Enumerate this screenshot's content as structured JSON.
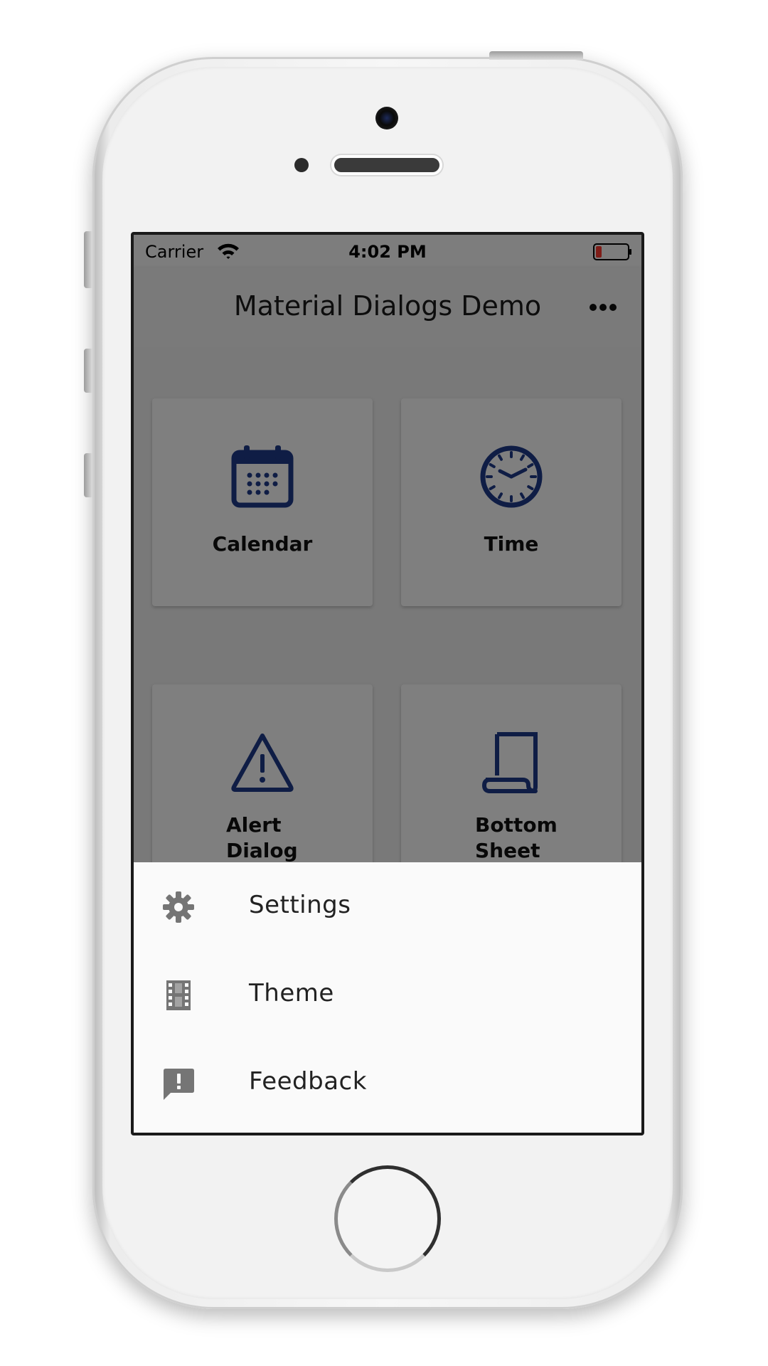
{
  "status_bar": {
    "carrier": "Carrier",
    "time": "4:02 PM",
    "wifi_icon": "wifi-icon",
    "battery_icon": "battery-low-icon",
    "battery_color": "#ff3b30"
  },
  "app_bar": {
    "title": "Material Dialogs Demo",
    "menu_icon": "more-horizontal-icon"
  },
  "cards": [
    {
      "label": "Calendar",
      "icon": "calendar-icon"
    },
    {
      "label": "Time",
      "icon": "clock-icon"
    },
    {
      "label": "Alert Dialog",
      "icon": "warning-icon"
    },
    {
      "label": "Bottom Sheet",
      "icon": "scroll-icon"
    }
  ],
  "bottom_sheet": {
    "items": [
      {
        "label": "Settings",
        "icon": "gear-icon"
      },
      {
        "label": "Theme",
        "icon": "film-icon"
      },
      {
        "label": "Feedback",
        "icon": "feedback-icon"
      }
    ]
  },
  "colors": {
    "accent": "#1f3a8a",
    "scrim": "rgba(0,0,0,0.5)",
    "sheet_icon": "#757575"
  }
}
